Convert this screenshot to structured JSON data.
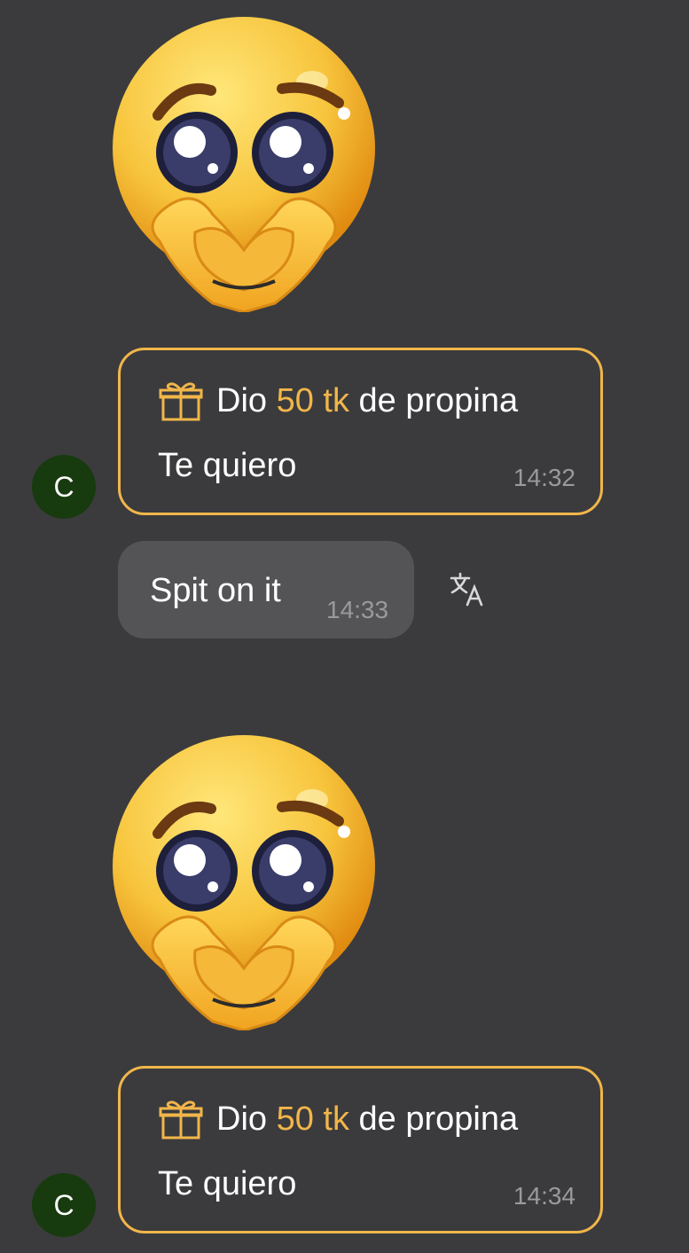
{
  "messages": [
    {
      "sticker": "pleading-face-heart-hands-sticker",
      "tip": {
        "prefix": "Dio",
        "amount": "50 tk",
        "suffix": "de propina",
        "message": "Te quiero",
        "time": "14:32"
      },
      "avatar_letter": "C"
    },
    {
      "text": "Spit on it",
      "time": "14:33",
      "icon": "translate-icon"
    },
    {
      "sticker": "pleading-face-heart-hands-sticker",
      "tip": {
        "prefix": "Dio",
        "amount": "50 tk",
        "suffix": "de propina",
        "message": "Te quiero",
        "time": "14:34"
      },
      "avatar_letter": "C"
    }
  ],
  "colors": {
    "background": "#3b3b3d",
    "accent": "#f1b64a",
    "bubble": "#545457",
    "avatar": "#173a0e",
    "timestamp": "#9a9a9d"
  }
}
